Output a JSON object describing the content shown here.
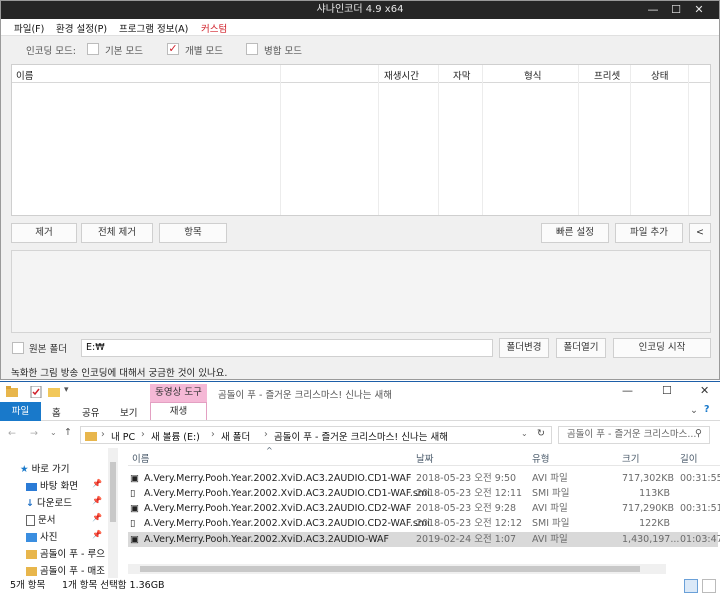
{
  "encoder": {
    "title": "샤나인코더 4.9 x64",
    "window_controls": [
      "—",
      "☐",
      "✕"
    ],
    "menu": [
      "파일(F)",
      "환경 설정(P)",
      "프로그램 정보(A)",
      "커스텀"
    ],
    "mode_label": "인코딩 모드:",
    "modes": [
      {
        "label": "기본 모드",
        "checked": false
      },
      {
        "label": "개별 모드",
        "checked": true
      },
      {
        "label": "병합 모드",
        "checked": false
      }
    ],
    "columns": [
      "이름",
      "재생시간",
      "자막",
      "형식",
      "프리셋",
      "상태"
    ],
    "buttons": {
      "remove": "제거",
      "remove_all": "전체 제거",
      "item": "항목",
      "quick_settings": "빠른 설정",
      "add_file": "파일 추가",
      "collapse": "<"
    },
    "original_folder_label": "원본 폴더",
    "output_path": "E:₩",
    "change_folder": "폴더변경",
    "open_folder": "폴더열기",
    "start_encoding": "인코딩 시작",
    "notice": "녹화한 그림 방송 인코딩에 대해서 궁금한 것이 있나요."
  },
  "explorer": {
    "context_tab": "동영상 도구",
    "context_subtab": "재생",
    "window_title": "곰돌이 푸 - 즐거운 크리스마스! 신나는 새해",
    "title_controls": [
      "—",
      "☐",
      "✕"
    ],
    "ribbon_tabs": [
      "파일",
      "홈",
      "공유",
      "보기"
    ],
    "breadcrumb": [
      "내 PC",
      "새 볼륨 (E:)",
      "새 폴더",
      "곰돌이 푸 - 즐거운 크리스마스! 신나는 새해"
    ],
    "search_placeholder": "곰돌이 푸 - 즐거운 크리스마스...",
    "nav": [
      {
        "label": "바로 가기",
        "icon": "star-icon"
      },
      {
        "label": "바탕 화면",
        "icon": "desktop-icon"
      },
      {
        "label": "다운로드",
        "icon": "download-icon"
      },
      {
        "label": "문서",
        "icon": "document-icon"
      },
      {
        "label": "사진",
        "icon": "picture-icon"
      },
      {
        "label": "곰돌이 푸 - 루으",
        "icon": "folder-icon"
      },
      {
        "label": "곰돌이 푸 - 매조",
        "icon": "folder-icon"
      }
    ],
    "columns": [
      "이름",
      "날짜",
      "유형",
      "크기",
      "길이"
    ],
    "files": [
      {
        "name": "A.Very.Merry.Pooh.Year.2002.XviD.AC3.2AUDIO.CD1-WAF",
        "date": "2018-05-23 오전 9:50",
        "type": "AVI 파일",
        "size": "717,302KB",
        "length": "00:31:55",
        "selected": false
      },
      {
        "name": "A.Very.Merry.Pooh.Year.2002.XviD.AC3.2AUDIO.CD1-WAF.smi",
        "date": "2018-05-23 오전 12:11",
        "type": "SMI 파일",
        "size": "113KB",
        "length": "",
        "selected": false
      },
      {
        "name": "A.Very.Merry.Pooh.Year.2002.XviD.AC3.2AUDIO.CD2-WAF",
        "date": "2018-05-23 오전 9:28",
        "type": "AVI 파일",
        "size": "717,290KB",
        "length": "00:31:51",
        "selected": false
      },
      {
        "name": "A.Very.Merry.Pooh.Year.2002.XviD.AC3.2AUDIO.CD2-WAF.smi",
        "date": "2018-05-23 오전 12:12",
        "type": "SMI 파일",
        "size": "122KB",
        "length": "",
        "selected": false
      },
      {
        "name": "A.Very.Merry.Pooh.Year.2002.XviD.AC3.2AUDIO-WAF",
        "date": "2019-02-24 오전 1:07",
        "type": "AVI 파일",
        "size": "1,430,197...",
        "length": "01:03:47",
        "selected": true
      }
    ],
    "status_count": "5개 항목",
    "status_selected": "1개 항목 선택함 1.36GB"
  }
}
